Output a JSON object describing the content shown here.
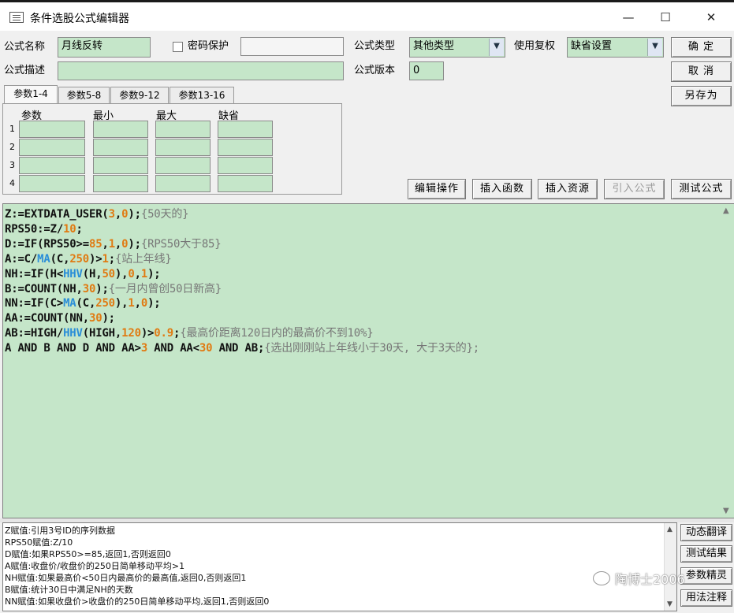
{
  "window": {
    "title": "条件选股公式编辑器",
    "minimize_glyph": "—",
    "maximize_glyph": "☐",
    "close_glyph": "✕"
  },
  "form": {
    "name_label": "公式名称",
    "name_value": "月线反转",
    "password_label": "密码保护",
    "password_checked": false,
    "password_value": "",
    "desc_label": "公式描述",
    "desc_value": "",
    "type_label": "公式类型",
    "type_value": "其他类型",
    "rights_label": "使用复权",
    "rights_value": "缺省设置",
    "version_label": "公式版本",
    "version_value": "0"
  },
  "buttons": {
    "ok": "确  定",
    "cancel": "取  消",
    "save_as": "另存为",
    "edit_ops": "编辑操作",
    "insert_func": "插入函数",
    "insert_resource": "插入资源",
    "import_formula": "引入公式",
    "test_formula": "测试公式"
  },
  "tabs": [
    "参数1-4",
    "参数5-8",
    "参数9-12",
    "参数13-16"
  ],
  "param_table": {
    "headers": [
      "参数",
      "最小",
      "最大",
      "缺省"
    ],
    "rows": [
      "1",
      "2",
      "3",
      "4"
    ]
  },
  "code_lines": [
    [
      {
        "t": "Z:=EXTDATA_USER(",
        "c": "k"
      },
      {
        "t": "3",
        "c": "n"
      },
      {
        "t": ",",
        "c": "k"
      },
      {
        "t": "0",
        "c": "n"
      },
      {
        "t": ");",
        "c": "k"
      },
      {
        "t": "{50天的}",
        "c": "c"
      }
    ],
    [
      {
        "t": "RPS50:=Z/",
        "c": "k"
      },
      {
        "t": "10",
        "c": "n"
      },
      {
        "t": ";",
        "c": "k"
      }
    ],
    [
      {
        "t": "D:=IF(RPS50>=",
        "c": "k"
      },
      {
        "t": "85",
        "c": "n"
      },
      {
        "t": ",",
        "c": "k"
      },
      {
        "t": "1",
        "c": "n"
      },
      {
        "t": ",",
        "c": "k"
      },
      {
        "t": "0",
        "c": "n"
      },
      {
        "t": ");",
        "c": "k"
      },
      {
        "t": "{RPS50大于85}",
        "c": "c"
      }
    ],
    [
      {
        "t": "A:=C/",
        "c": "k"
      },
      {
        "t": "MA",
        "c": "f"
      },
      {
        "t": "(C,",
        "c": "k"
      },
      {
        "t": "250",
        "c": "n"
      },
      {
        "t": ")>",
        "c": "k"
      },
      {
        "t": "1",
        "c": "n"
      },
      {
        "t": ";",
        "c": "k"
      },
      {
        "t": "{站上年线}",
        "c": "c"
      }
    ],
    [
      {
        "t": "NH:=IF(H<",
        "c": "k"
      },
      {
        "t": "HHV",
        "c": "f"
      },
      {
        "t": "(H,",
        "c": "k"
      },
      {
        "t": "50",
        "c": "n"
      },
      {
        "t": "),",
        "c": "k"
      },
      {
        "t": "0",
        "c": "n"
      },
      {
        "t": ",",
        "c": "k"
      },
      {
        "t": "1",
        "c": "n"
      },
      {
        "t": ");",
        "c": "k"
      }
    ],
    [
      {
        "t": "B:=COUNT(NH,",
        "c": "k"
      },
      {
        "t": "30",
        "c": "n"
      },
      {
        "t": ");",
        "c": "k"
      },
      {
        "t": "{一月内曾创50日新高}",
        "c": "c"
      }
    ],
    [
      {
        "t": "NN:=IF(C>",
        "c": "k"
      },
      {
        "t": "MA",
        "c": "f"
      },
      {
        "t": "(C,",
        "c": "k"
      },
      {
        "t": "250",
        "c": "n"
      },
      {
        "t": "),",
        "c": "k"
      },
      {
        "t": "1",
        "c": "n"
      },
      {
        "t": ",",
        "c": "k"
      },
      {
        "t": "0",
        "c": "n"
      },
      {
        "t": ");",
        "c": "k"
      }
    ],
    [
      {
        "t": "AA:=COUNT(NN,",
        "c": "k"
      },
      {
        "t": "30",
        "c": "n"
      },
      {
        "t": ");",
        "c": "k"
      }
    ],
    [
      {
        "t": "AB:=HIGH/",
        "c": "k"
      },
      {
        "t": "HHV",
        "c": "f"
      },
      {
        "t": "(HIGH,",
        "c": "k"
      },
      {
        "t": "120",
        "c": "n"
      },
      {
        "t": ")>",
        "c": "k"
      },
      {
        "t": "0.9",
        "c": "n"
      },
      {
        "t": ";",
        "c": "k"
      },
      {
        "t": "{最高价距离120日内的最高价不到10%}",
        "c": "c"
      }
    ],
    [
      {
        "t": "A AND B AND D AND AA>",
        "c": "k"
      },
      {
        "t": "3",
        "c": "n"
      },
      {
        "t": " AND AA<",
        "c": "k"
      },
      {
        "t": "30",
        "c": "n"
      },
      {
        "t": " AND AB;",
        "c": "k"
      },
      {
        "t": "{选出刚刚站上年线小于30天, 大于3天的};",
        "c": "c"
      }
    ]
  ],
  "explain_lines": [
    "Z赋值:引用3号ID的序列数据",
    "RPS50赋值:Z/10",
    "D赋值:如果RPS50>=85,返回1,否则返回0",
    "A赋值:收盘价/收盘价的250日简单移动平均>1",
    "NH赋值:如果最高价<50日内最高价的最高值,返回0,否则返回1",
    "B赋值:统计30日中满足NH的天数",
    "NN赋值:如果收盘价>收盘价的250日简单移动平均,返回1,否则返回0"
  ],
  "side_buttons": [
    "动态翻译",
    "测试结果",
    "参数精灵",
    "用法注释"
  ],
  "watermark": "陶博士2006",
  "colors": {
    "field_bg": "#c5e6c9",
    "number": "#e07a12",
    "function": "#2a8ed8",
    "comment": "#777777"
  }
}
